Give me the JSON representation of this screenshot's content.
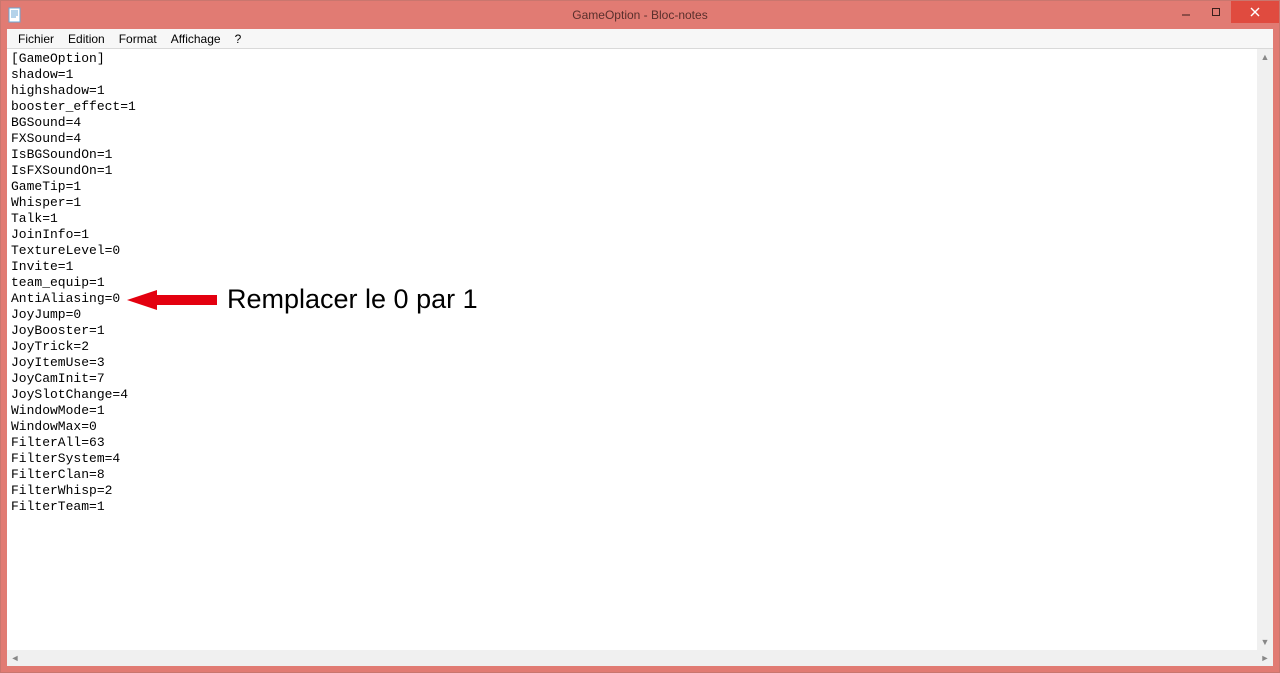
{
  "window": {
    "title": "GameOption - Bloc-notes"
  },
  "menubar": {
    "items": [
      "Fichier",
      "Edition",
      "Format",
      "Affichage",
      "?"
    ]
  },
  "editor": {
    "lines": [
      "[GameOption]",
      "shadow=1",
      "highshadow=1",
      "booster_effect=1",
      "BGSound=4",
      "FXSound=4",
      "IsBGSoundOn=1",
      "IsFXSoundOn=1",
      "GameTip=1",
      "Whisper=1",
      "Talk=1",
      "JoinInfo=1",
      "TextureLevel=0",
      "Invite=1",
      "team_equip=1",
      "AntiAliasing=0",
      "JoyJump=0",
      "JoyBooster=1",
      "JoyTrick=2",
      "JoyItemUse=3",
      "JoyCamInit=7",
      "JoySlotChange=4",
      "WindowMode=1",
      "WindowMax=0",
      "FilterAll=63",
      "FilterSystem=4",
      "FilterClan=8",
      "FilterWhisp=2",
      "FilterTeam=1"
    ]
  },
  "annotation": {
    "text": "Remplacer le 0 par 1",
    "color": "#e3000f"
  }
}
